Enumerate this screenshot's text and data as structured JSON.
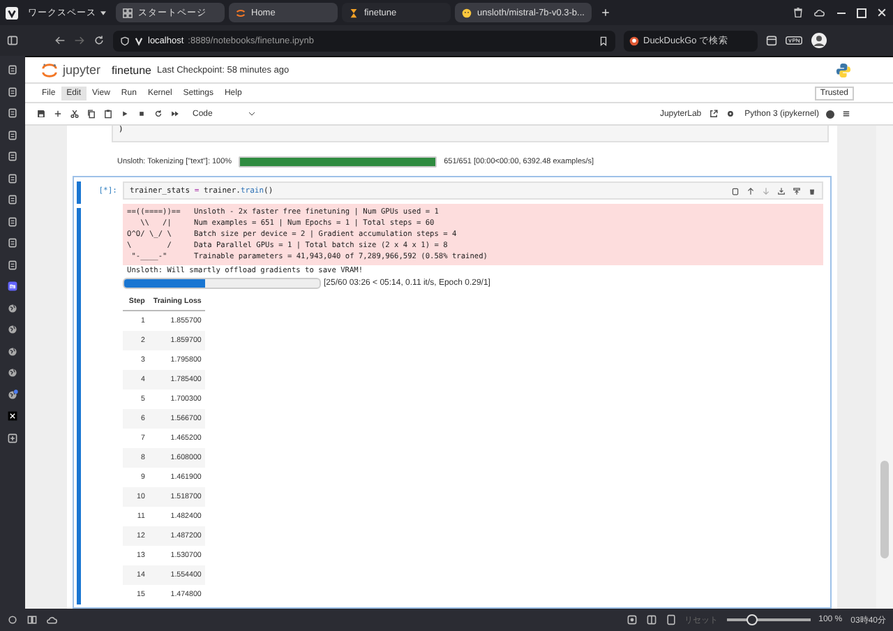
{
  "browser": {
    "workspace": "ワークスペース",
    "tabs": [
      {
        "label": "スタートページ",
        "selected": false,
        "kind": "grid"
      },
      {
        "label": "Home",
        "selected": false,
        "kind": "jupyter"
      },
      {
        "label": "finetune",
        "selected": true,
        "kind": "hourglass"
      },
      {
        "label": "unsloth/mistral-7b-v0.3-b...",
        "selected": false,
        "kind": "hf"
      }
    ],
    "address": {
      "host": "localhost",
      "path": ":8889/notebooks/finetune.ipynb"
    },
    "search": {
      "placeholder": "DuckDuckGo で検索"
    }
  },
  "notebook": {
    "title": "finetune",
    "checkpoint": "Last Checkpoint: 58 minutes ago",
    "menus": [
      {
        "label": "File",
        "selected": false
      },
      {
        "label": "Edit",
        "selected": true
      },
      {
        "label": "View",
        "selected": false
      },
      {
        "label": "Run",
        "selected": false
      },
      {
        "label": "Kernel",
        "selected": false
      },
      {
        "label": "Settings",
        "selected": false
      },
      {
        "label": "Help",
        "selected": false
      }
    ],
    "trusted": "Trusted",
    "cell_type": "Code",
    "jupyterlab": "JupyterLab",
    "kernel": "Python 3 (ipykernel)",
    "kernel_busy": true
  },
  "prev_cell": {
    "code_tail": ")",
    "output": {
      "label": "Unsloth: Tokenizing [\"text\"]: 100%",
      "level": 1,
      "reading": "651/651 [00:00<00:00, 6392.48 examples/s]"
    }
  },
  "cell": {
    "prompt": "[*]:",
    "code": [
      {
        "text": "trainer_stats ",
        "kind": "name"
      },
      {
        "text": "=",
        "kind": "op"
      },
      {
        "text": " trainer.",
        "kind": "name"
      },
      {
        "text": "train",
        "kind": "attr"
      },
      {
        "text": "()",
        "kind": "name"
      }
    ],
    "stderr": [
      {
        "art": "==((====))==",
        "text": "Unsloth - 2x faster free finetuning | Num GPUs used = 1"
      },
      {
        "art": "   \\\\   /|",
        "text": "Num examples = 651 | Num Epochs = 1 | Total steps = 60"
      },
      {
        "art": "O^O/ \\_/ \\",
        "text": "Batch size per device = 2 | Gradient accumulation steps = 4"
      },
      {
        "art": "\\        /",
        "text": "Data Parallel GPUs = 1 | Total batch size (2 x 4 x 1) = 8"
      },
      {
        "art": " \"-____-\"",
        "text": "Trainable parameters = 41,943,040 of 7,289,966,592 (0.58% trained)"
      }
    ],
    "note": "Unsloth: Will smartly offload gradients to save VRAM!",
    "progress": {
      "level": 0.417,
      "reading": "[25/60 03:26 < 05:14, 0.11 it/s, Epoch 0.29/1]"
    },
    "table": {
      "columns": [
        "Step",
        "Training Loss"
      ],
      "rows": [
        [
          "1",
          "1.855700"
        ],
        [
          "2",
          "1.859700"
        ],
        [
          "3",
          "1.795800"
        ],
        [
          "4",
          "1.785400"
        ],
        [
          "5",
          "1.700300"
        ],
        [
          "6",
          "1.566700"
        ],
        [
          "7",
          "1.465200"
        ],
        [
          "8",
          "1.608000"
        ],
        [
          "9",
          "1.461900"
        ],
        [
          "10",
          "1.518700"
        ],
        [
          "11",
          "1.482400"
        ],
        [
          "12",
          "1.487200"
        ],
        [
          "13",
          "1.530700"
        ],
        [
          "14",
          "1.554400"
        ],
        [
          "15",
          "1.474800"
        ]
      ]
    }
  },
  "status_bar": {
    "reset": "リセット",
    "zoom": "100 %",
    "zoom_slider": {
      "level": 0.3
    },
    "time": "03時40分"
  }
}
